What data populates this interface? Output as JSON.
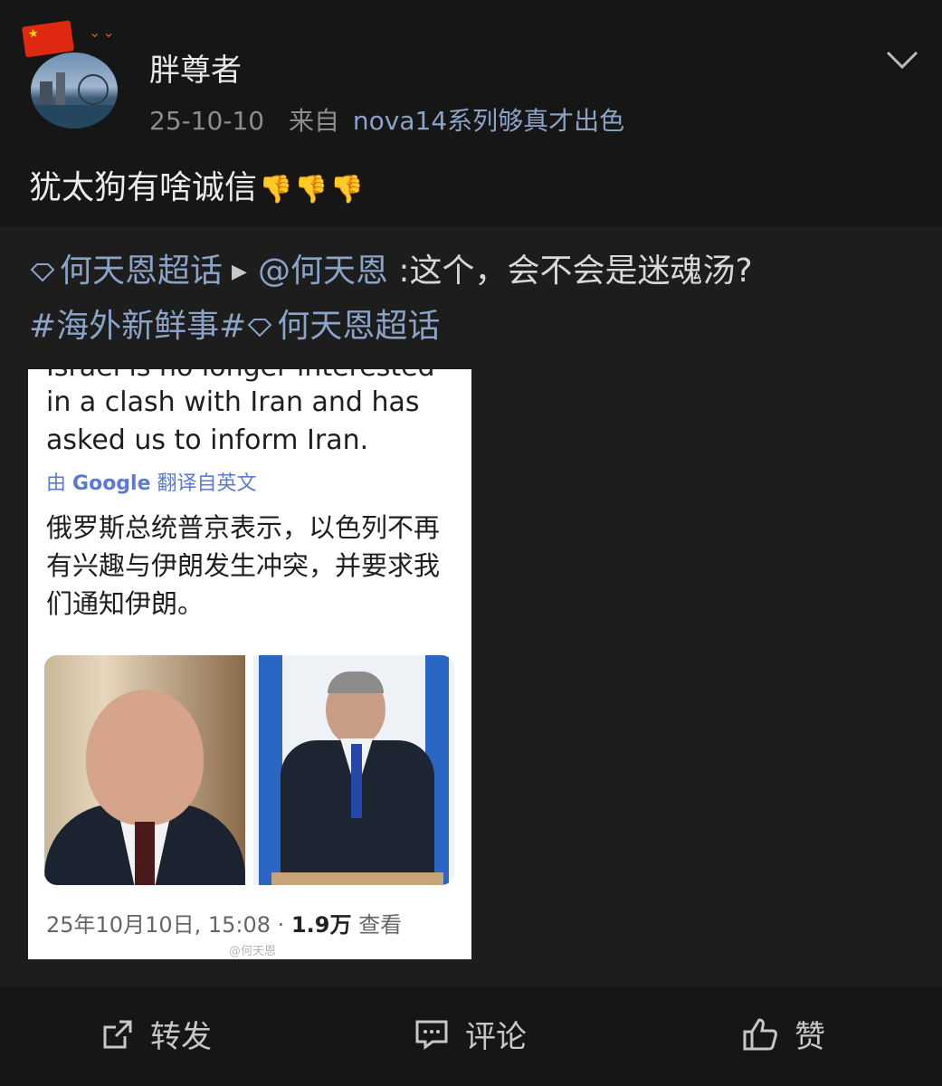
{
  "post": {
    "username": "胖尊者",
    "date": "25-10-10",
    "from_label": "来自",
    "source": "nova14系列够真才出色",
    "text": "犹太狗有啥诚信",
    "thumbs": [
      "👎",
      "👎",
      "👎"
    ]
  },
  "repost": {
    "topic": "何天恩超话",
    "mention": "@何天恩",
    "text": ":这个，会不会是迷魂汤?",
    "hashtag": "#海外新鲜事#",
    "topic2": "何天恩超话"
  },
  "card": {
    "cut_line": "Israel is no longer interested",
    "english": "in a clash with Iran and has asked us to inform Iran.",
    "translated_prefix": "由",
    "translated_brand": "Google",
    "translated_suffix": "翻译自英文",
    "chinese": "俄罗斯总统普京表示，以色列不再有兴趣与伊朗发生冲突，并要求我们通知伊朗。",
    "timestamp": "25年10月10日, 15:08 · ",
    "views": "1.9万",
    "views_label": " 查看",
    "watermark": "@何天恩"
  },
  "actions": {
    "repost": "转发",
    "comment": "评论",
    "like": "赞"
  },
  "colors": {
    "link": "#8aa3c6",
    "background": "#1d1d1d",
    "panel": "#161616"
  }
}
